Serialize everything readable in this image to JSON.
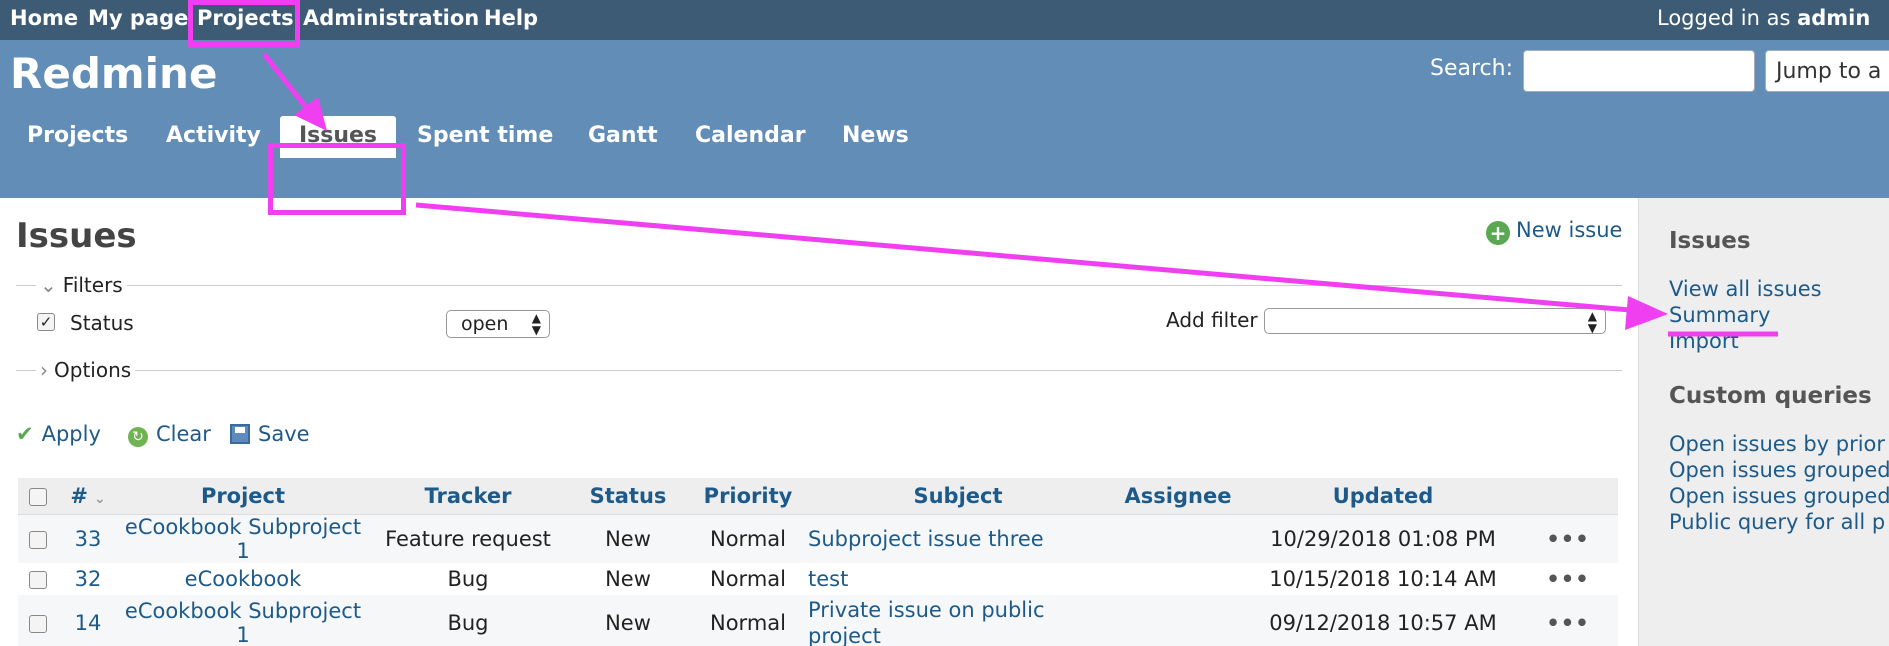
{
  "top_menu": {
    "items": [
      "Home",
      "My page",
      "Projects",
      "Administration",
      "Help"
    ],
    "logged_prefix": "Logged in as",
    "user": "admin"
  },
  "header": {
    "site_title": "Redmine",
    "search_label": "Search:",
    "search_value": "",
    "jump_label": "Jump to a"
  },
  "main_menu": {
    "tabs": [
      "Projects",
      "Activity",
      "Issues",
      "Spent time",
      "Gantt",
      "Calendar",
      "News"
    ],
    "selected": "Issues"
  },
  "content": {
    "title": "Issues",
    "new_issue": "New issue",
    "filters_legend": "Filters",
    "status_filter": {
      "label": "Status",
      "checked": true,
      "operator": "open"
    },
    "add_filter_label": "Add filter",
    "options_legend": "Options",
    "actions": {
      "apply": "Apply",
      "clear": "Clear",
      "save": "Save"
    }
  },
  "table": {
    "headers": [
      "#",
      "Project",
      "Tracker",
      "Status",
      "Priority",
      "Subject",
      "Assignee",
      "Updated"
    ],
    "rows": [
      {
        "id": "33",
        "project": "eCookbook Subproject 1",
        "tracker": "Feature request",
        "status": "New",
        "priority": "Normal",
        "subject_1": "Subproject issue three",
        "subject_2": "",
        "assignee": "",
        "updated": "10/29/2018 01:08 PM"
      },
      {
        "id": "32",
        "project": "eCookbook",
        "tracker": "Bug",
        "status": "New",
        "priority": "Normal",
        "subject_1": "test",
        "subject_2": "",
        "assignee": "",
        "updated": "10/15/2018 10:14 AM"
      },
      {
        "id": "14",
        "project": "eCookbook Subproject 1",
        "tracker": "Bug",
        "status": "New",
        "priority": "Normal",
        "subject_1": "Private issue on public",
        "subject_2": "project",
        "assignee": "",
        "updated": "09/12/2018 10:57 AM"
      }
    ],
    "row_menu": "•••"
  },
  "sidebar": {
    "issues_heading": "Issues",
    "links": [
      "View all issues",
      "Summary",
      "Import"
    ],
    "queries_heading": "Custom queries",
    "queries": [
      "Open issues by prior",
      "Open issues grouped",
      "Open issues grouped",
      "Public query for all p"
    ]
  },
  "annotation_color": "#ef3ff0"
}
